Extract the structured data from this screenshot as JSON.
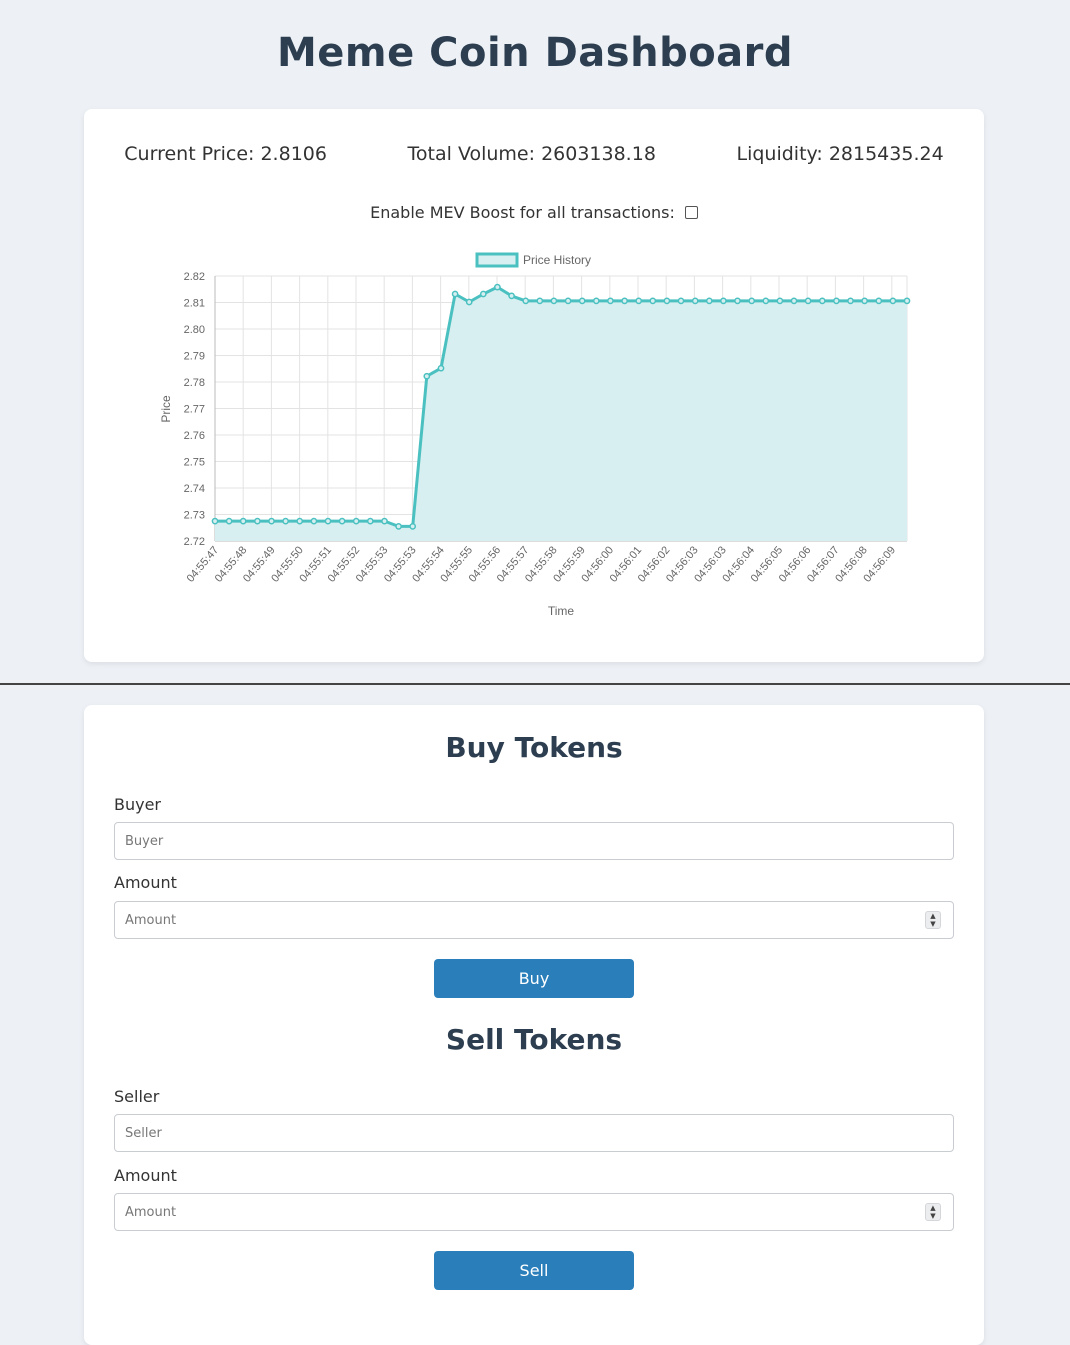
{
  "page": {
    "title": "Meme Coin Dashboard"
  },
  "stats": {
    "current_price": "Current Price: 2.8106",
    "total_volume": "Total Volume: 2603138.18",
    "liquidity": "Liquidity: 2815435.24"
  },
  "mev": {
    "label": "Enable MEV Boost for all transactions:",
    "checked": false
  },
  "buy": {
    "title": "Buy Tokens",
    "buyer_label": "Buyer",
    "buyer_placeholder": "Buyer",
    "amount_label": "Amount",
    "amount_placeholder": "Amount",
    "button": "Buy"
  },
  "sell": {
    "title": "Sell Tokens",
    "seller_label": "Seller",
    "seller_placeholder": "Seller",
    "amount_label": "Amount",
    "amount_placeholder": "Amount",
    "button": "Sell"
  },
  "chart_data": {
    "type": "area",
    "legend": "Price History",
    "legend_position": "top",
    "xlabel": "Time",
    "ylabel": "Price",
    "ylim": [
      2.72,
      2.82
    ],
    "yticks": [
      "2.82",
      "2.81",
      "2.80",
      "2.79",
      "2.78",
      "2.77",
      "2.76",
      "2.75",
      "2.74",
      "2.73",
      "2.72"
    ],
    "grid": true,
    "line_color": "#4bc0c0",
    "fill_color": "#d7eff0",
    "xtick_labels": [
      "04:55:47",
      "04:55:48",
      "04:55:49",
      "04:55:50",
      "04:55:51",
      "04:55:52",
      "04:55:53",
      "04:55:53",
      "04:55:54",
      "04:55:55",
      "04:55:56",
      "04:55:57",
      "04:55:58",
      "04:55:59",
      "04:56:00",
      "04:56:01",
      "04:56:02",
      "04:56:03",
      "04:56:03",
      "04:56:04",
      "04:56:05",
      "04:56:06",
      "04:56:07",
      "04:56:08",
      "04:56:09"
    ],
    "values": [
      2.7275,
      2.7275,
      2.7275,
      2.7275,
      2.7275,
      2.7275,
      2.7275,
      2.7275,
      2.7275,
      2.7275,
      2.7275,
      2.7275,
      2.7275,
      2.7255,
      2.7255,
      2.7822,
      2.7852,
      2.8132,
      2.8102,
      2.8132,
      2.8158,
      2.8125,
      2.8106,
      2.8106,
      2.8106,
      2.8106,
      2.8106,
      2.8106,
      2.8106,
      2.8106,
      2.8106,
      2.8106,
      2.8106,
      2.8106,
      2.8106,
      2.8106,
      2.8106,
      2.8106,
      2.8106,
      2.8106,
      2.8106,
      2.8106,
      2.8106,
      2.8106,
      2.8106,
      2.8106,
      2.8106,
      2.8106,
      2.8106,
      2.8106
    ]
  }
}
